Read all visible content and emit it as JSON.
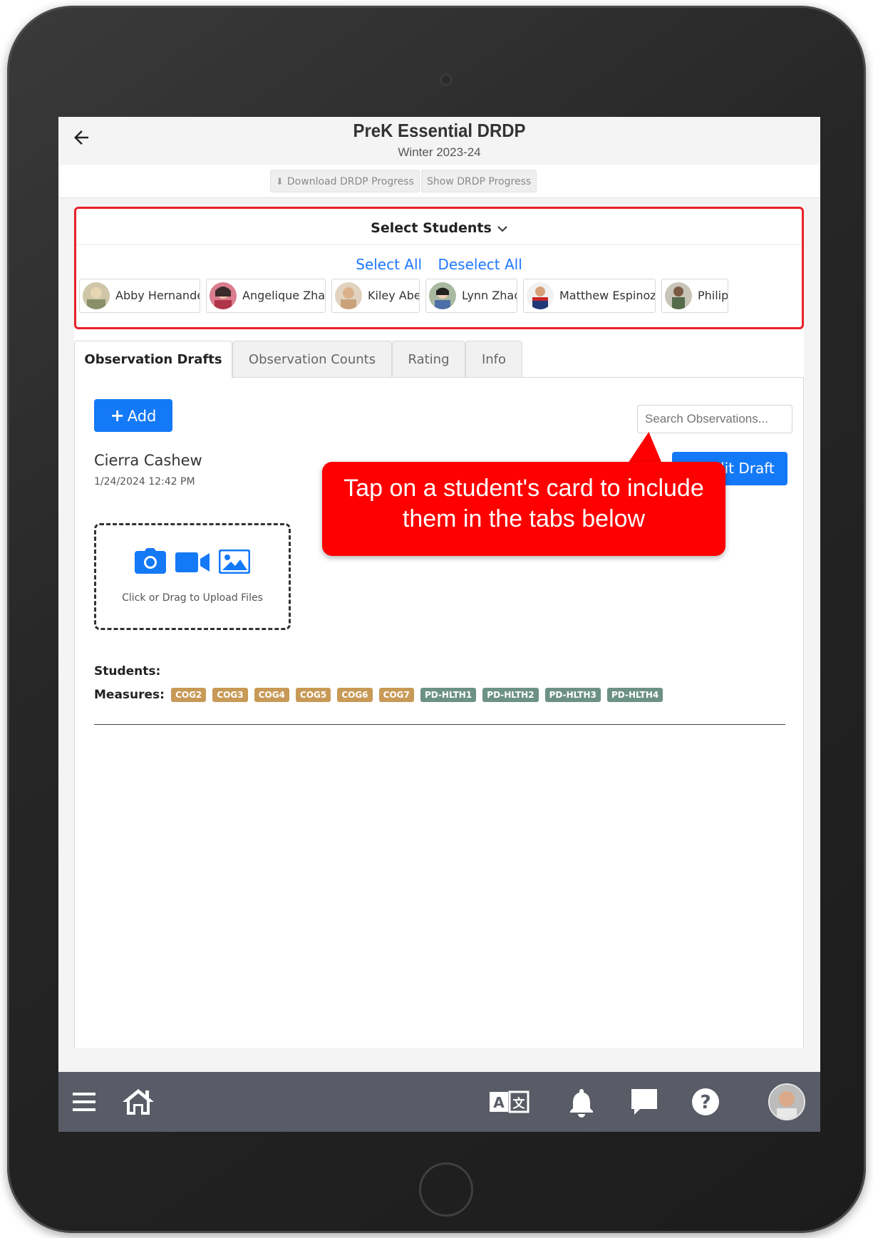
{
  "header": {
    "title": "PreK Essential DRDP",
    "subtitle": "Winter 2023-24"
  },
  "toolbar": {
    "download_label": "Download DRDP Progress",
    "show_label": "Show DRDP Progress"
  },
  "student_selector": {
    "heading": "Select Students",
    "select_all": "Select All",
    "deselect_all": "Deselect All",
    "students": [
      {
        "name": "Abby Hernandez"
      },
      {
        "name": "Angelique Zhao"
      },
      {
        "name": "Kiley Abel"
      },
      {
        "name": "Lynn Zhao"
      },
      {
        "name": "Matthew Espinoza"
      },
      {
        "name": "Philip"
      }
    ]
  },
  "tabs": [
    {
      "label": "Observation Drafts",
      "active": true
    },
    {
      "label": "Observation Counts",
      "active": false
    },
    {
      "label": "Rating",
      "active": false
    },
    {
      "label": "Info",
      "active": false
    }
  ],
  "drafts": {
    "add_label": "Add",
    "search_placeholder": "Search Observations...",
    "edit_label": "Edit Draft",
    "item": {
      "name": "Cierra Cashew",
      "date": "1/24/2024 12:42 PM",
      "upload_text": "Click or Drag to Upload Files",
      "students_label": "Students:",
      "measures_label": "Measures:",
      "measures": [
        "COG2",
        "COG3",
        "COG4",
        "COG5",
        "COG6",
        "COG7",
        "PD-HLTH1",
        "PD-HLTH2",
        "PD-HLTH3",
        "PD-HLTH4"
      ]
    }
  },
  "callout": {
    "line1": "Tap on a student's card to include",
    "line2": "them in the tabs below"
  },
  "colors": {
    "primary": "#1479f7",
    "link": "#1e78ff",
    "highlight": "#e8202a",
    "callout": "#ff0000",
    "cog_badge": "#c89a57",
    "pd_badge": "#6d9186",
    "nav_bar": "#595c66"
  },
  "icons": {
    "back": "arrow-left-icon",
    "download": "download-icon",
    "chevron": "chevron-down-icon",
    "add": "plus-icon",
    "edit": "pencil-icon",
    "upload": [
      "camera-icon",
      "video-icon",
      "image-icon"
    ],
    "nav": [
      "menu-icon",
      "home-icon",
      "translate-icon",
      "bell-icon",
      "chat-icon",
      "help-icon",
      "profile-avatar"
    ]
  }
}
